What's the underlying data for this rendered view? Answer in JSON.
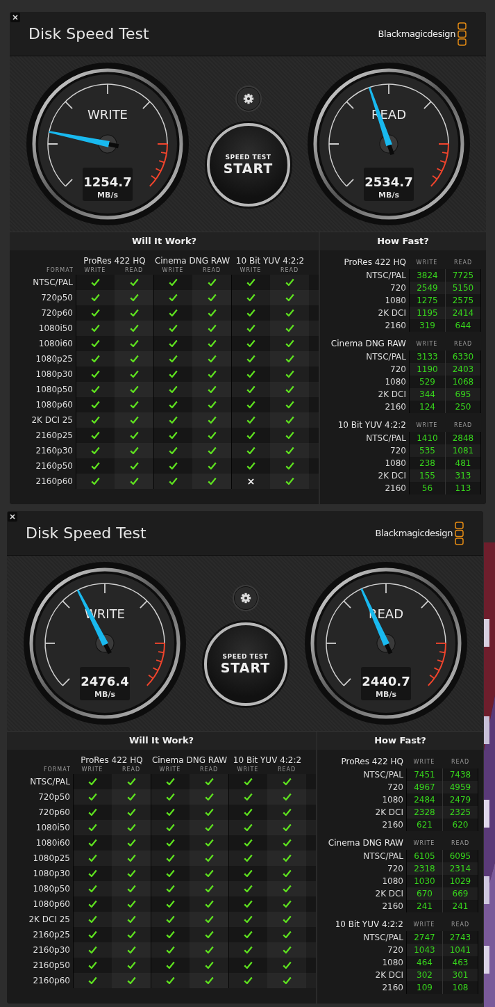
{
  "windows": [
    {
      "title": "Disk Speed Test",
      "brand": "Blackmagicdesign",
      "gauges": [
        {
          "label": "WRITE",
          "value": "1254.7",
          "unit": "MB/s",
          "level": 0.21
        },
        {
          "label": "READ",
          "value": "2534.7",
          "unit": "MB/s",
          "level": 0.43
        }
      ],
      "start": {
        "caption": "SPEED TEST",
        "label": "START"
      },
      "will_it_work": {
        "title": "Will It Work?",
        "format_label": "FORMAT",
        "codecs": [
          {
            "name": "ProRes 422 HQ",
            "columns": [
              "WRITE",
              "READ"
            ]
          },
          {
            "name": "Cinema DNG RAW",
            "columns": [
              "WRITE",
              "READ"
            ]
          },
          {
            "name": "10 Bit YUV 4:2:2",
            "columns": [
              "WRITE",
              "READ"
            ]
          }
        ],
        "rows": [
          {
            "format": "NTSC/PAL",
            "results": [
              true,
              true,
              true,
              true,
              true,
              true
            ]
          },
          {
            "format": "720p50",
            "results": [
              true,
              true,
              true,
              true,
              true,
              true
            ]
          },
          {
            "format": "720p60",
            "results": [
              true,
              true,
              true,
              true,
              true,
              true
            ]
          },
          {
            "format": "1080i50",
            "results": [
              true,
              true,
              true,
              true,
              true,
              true
            ]
          },
          {
            "format": "1080i60",
            "results": [
              true,
              true,
              true,
              true,
              true,
              true
            ]
          },
          {
            "format": "1080p25",
            "results": [
              true,
              true,
              true,
              true,
              true,
              true
            ]
          },
          {
            "format": "1080p30",
            "results": [
              true,
              true,
              true,
              true,
              true,
              true
            ]
          },
          {
            "format": "1080p50",
            "results": [
              true,
              true,
              true,
              true,
              true,
              true
            ]
          },
          {
            "format": "1080p60",
            "results": [
              true,
              true,
              true,
              true,
              true,
              true
            ]
          },
          {
            "format": "2K DCI 25",
            "results": [
              true,
              true,
              true,
              true,
              true,
              true
            ]
          },
          {
            "format": "2160p25",
            "results": [
              true,
              true,
              true,
              true,
              true,
              true
            ]
          },
          {
            "format": "2160p30",
            "results": [
              true,
              true,
              true,
              true,
              true,
              true
            ]
          },
          {
            "format": "2160p50",
            "results": [
              true,
              true,
              true,
              true,
              true,
              true
            ]
          },
          {
            "format": "2160p60",
            "results": [
              true,
              true,
              true,
              true,
              false,
              true
            ]
          }
        ]
      },
      "how_fast": {
        "title": "How Fast?",
        "groups": [
          {
            "name": "ProRes 422 HQ",
            "columns": [
              "WRITE",
              "READ"
            ],
            "rows": [
              {
                "format": "NTSC/PAL",
                "write": "3824",
                "read": "7725"
              },
              {
                "format": "720",
                "write": "2549",
                "read": "5150"
              },
              {
                "format": "1080",
                "write": "1275",
                "read": "2575"
              },
              {
                "format": "2K DCI",
                "write": "1195",
                "read": "2414"
              },
              {
                "format": "2160",
                "write": "319",
                "read": "644"
              }
            ]
          },
          {
            "name": "Cinema DNG RAW",
            "columns": [
              "WRITE",
              "READ"
            ],
            "rows": [
              {
                "format": "NTSC/PAL",
                "write": "3133",
                "read": "6330"
              },
              {
                "format": "720",
                "write": "1190",
                "read": "2403"
              },
              {
                "format": "1080",
                "write": "529",
                "read": "1068"
              },
              {
                "format": "2K DCI",
                "write": "344",
                "read": "695"
              },
              {
                "format": "2160",
                "write": "124",
                "read": "250"
              }
            ]
          },
          {
            "name": "10 Bit YUV 4:2:2",
            "columns": [
              "WRITE",
              "READ"
            ],
            "rows": [
              {
                "format": "NTSC/PAL",
                "write": "1410",
                "read": "2848"
              },
              {
                "format": "720",
                "write": "535",
                "read": "1081"
              },
              {
                "format": "1080",
                "write": "238",
                "read": "481"
              },
              {
                "format": "2K DCI",
                "write": "155",
                "read": "313"
              },
              {
                "format": "2160",
                "write": "56",
                "read": "113"
              }
            ]
          }
        ]
      }
    },
    {
      "title": "Disk Speed Test",
      "brand": "Blackmagicdesign",
      "gauges": [
        {
          "label": "WRITE",
          "value": "2476.4",
          "unit": "MB/s",
          "level": 0.4
        },
        {
          "label": "READ",
          "value": "2440.7",
          "unit": "MB/s",
          "level": 0.41
        }
      ],
      "start": {
        "caption": "SPEED TEST",
        "label": "START"
      },
      "will_it_work": {
        "title": "Will It Work?",
        "format_label": "FORMAT",
        "codecs": [
          {
            "name": "ProRes 422 HQ",
            "columns": [
              "WRITE",
              "READ"
            ]
          },
          {
            "name": "Cinema DNG RAW",
            "columns": [
              "WRITE",
              "READ"
            ]
          },
          {
            "name": "10 Bit YUV 4:2:2",
            "columns": [
              "WRITE",
              "READ"
            ]
          }
        ],
        "rows": [
          {
            "format": "NTSC/PAL",
            "results": [
              true,
              true,
              true,
              true,
              true,
              true
            ]
          },
          {
            "format": "720p50",
            "results": [
              true,
              true,
              true,
              true,
              true,
              true
            ]
          },
          {
            "format": "720p60",
            "results": [
              true,
              true,
              true,
              true,
              true,
              true
            ]
          },
          {
            "format": "1080i50",
            "results": [
              true,
              true,
              true,
              true,
              true,
              true
            ]
          },
          {
            "format": "1080i60",
            "results": [
              true,
              true,
              true,
              true,
              true,
              true
            ]
          },
          {
            "format": "1080p25",
            "results": [
              true,
              true,
              true,
              true,
              true,
              true
            ]
          },
          {
            "format": "1080p30",
            "results": [
              true,
              true,
              true,
              true,
              true,
              true
            ]
          },
          {
            "format": "1080p50",
            "results": [
              true,
              true,
              true,
              true,
              true,
              true
            ]
          },
          {
            "format": "1080p60",
            "results": [
              true,
              true,
              true,
              true,
              true,
              true
            ]
          },
          {
            "format": "2K DCI 25",
            "results": [
              true,
              true,
              true,
              true,
              true,
              true
            ]
          },
          {
            "format": "2160p25",
            "results": [
              true,
              true,
              true,
              true,
              true,
              true
            ]
          },
          {
            "format": "2160p30",
            "results": [
              true,
              true,
              true,
              true,
              true,
              true
            ]
          },
          {
            "format": "2160p50",
            "results": [
              true,
              true,
              true,
              true,
              true,
              true
            ]
          },
          {
            "format": "2160p60",
            "results": [
              true,
              true,
              true,
              true,
              true,
              true
            ]
          }
        ]
      },
      "how_fast": {
        "title": "How Fast?",
        "groups": [
          {
            "name": "ProRes 422 HQ",
            "columns": [
              "WRITE",
              "READ"
            ],
            "rows": [
              {
                "format": "NTSC/PAL",
                "write": "7451",
                "read": "7438"
              },
              {
                "format": "720",
                "write": "4967",
                "read": "4959"
              },
              {
                "format": "1080",
                "write": "2484",
                "read": "2479"
              },
              {
                "format": "2K DCI",
                "write": "2328",
                "read": "2325"
              },
              {
                "format": "2160",
                "write": "621",
                "read": "620"
              }
            ]
          },
          {
            "name": "Cinema DNG RAW",
            "columns": [
              "WRITE",
              "READ"
            ],
            "rows": [
              {
                "format": "NTSC/PAL",
                "write": "6105",
                "read": "6095"
              },
              {
                "format": "720",
                "write": "2318",
                "read": "2314"
              },
              {
                "format": "1080",
                "write": "1030",
                "read": "1029"
              },
              {
                "format": "2K DCI",
                "write": "670",
                "read": "669"
              },
              {
                "format": "2160",
                "write": "241",
                "read": "241"
              }
            ]
          },
          {
            "name": "10 Bit YUV 4:2:2",
            "columns": [
              "WRITE",
              "READ"
            ],
            "rows": [
              {
                "format": "NTSC/PAL",
                "write": "2747",
                "read": "2743"
              },
              {
                "format": "720",
                "write": "1043",
                "read": "1041"
              },
              {
                "format": "1080",
                "write": "464",
                "read": "463"
              },
              {
                "format": "2K DCI",
                "write": "302",
                "read": "301"
              },
              {
                "format": "2160",
                "write": "109",
                "read": "108"
              }
            ]
          }
        ]
      }
    }
  ]
}
